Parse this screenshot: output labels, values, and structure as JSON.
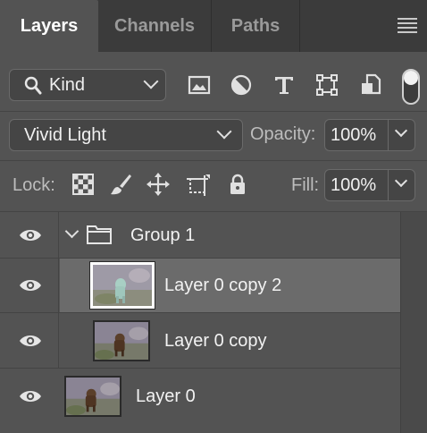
{
  "tabs": [
    {
      "label": "Layers",
      "active": true
    },
    {
      "label": "Channels",
      "active": false
    },
    {
      "label": "Paths",
      "active": false
    }
  ],
  "filter": {
    "kind_label": "Kind",
    "icons": [
      "image-filter-icon",
      "adjustment-filter-icon",
      "type-filter-icon",
      "shape-filter-icon",
      "smart-object-filter-icon"
    ]
  },
  "blend": {
    "mode": "Vivid Light",
    "opacity_label": "Opacity:",
    "opacity_value": "100%"
  },
  "lock": {
    "label": "Lock:",
    "fill_label": "Fill:",
    "fill_value": "100%"
  },
  "layers": [
    {
      "name": "Group 1",
      "type": "group",
      "visible": true
    },
    {
      "name": "Layer 0 copy 2",
      "type": "layer",
      "visible": true,
      "selected": true
    },
    {
      "name": "Layer 0 copy",
      "type": "layer",
      "visible": true
    },
    {
      "name": "Layer 0",
      "type": "layer",
      "visible": true
    }
  ],
  "colors": {
    "panel_bg": "#535353",
    "tabbar_bg": "#3b3b3b",
    "selected_row": "#6b6b6b"
  }
}
